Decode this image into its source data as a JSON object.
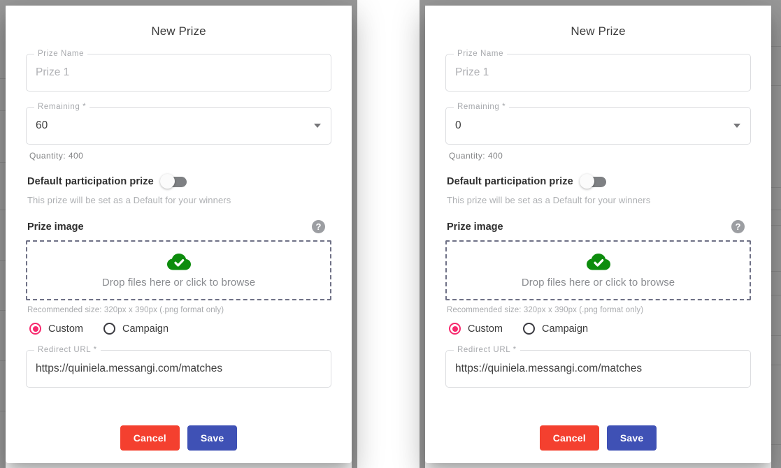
{
  "panels": [
    {
      "title": "New Prize",
      "prize_name": {
        "legend": "Prize Name",
        "value": "Prize 1"
      },
      "remaining": {
        "legend": "Remaining *",
        "value": "60"
      },
      "quantity_helper": "Quantity: 400",
      "default_prize": {
        "label": "Default participation prize",
        "sub": "This prize will be set as a Default for your winners",
        "state": "off"
      },
      "prize_image": {
        "title": "Prize image",
        "help_icon": "question-mark-icon",
        "dropzone_icon": "cloud-check-icon",
        "dropzone_text": "Drop files here or click to browse",
        "recommended": "Recommended size: 320px x 390px (.png format only)"
      },
      "image_source": {
        "options": [
          "Custom",
          "Campaign"
        ],
        "selected": "Custom"
      },
      "redirect_url": {
        "legend": "Redirect URL *",
        "value": "https://quiniela.messangi.com/matches"
      },
      "actions": {
        "cancel": "Cancel",
        "save": "Save"
      }
    },
    {
      "title": "New Prize",
      "prize_name": {
        "legend": "Prize Name",
        "value": "Prize 1"
      },
      "remaining": {
        "legend": "Remaining *",
        "value": "0"
      },
      "quantity_helper": "Quantity: 400",
      "default_prize": {
        "label": "Default participation prize",
        "sub": "This prize will be set as a Default for your winners",
        "state": "off"
      },
      "prize_image": {
        "title": "Prize image",
        "help_icon": "question-mark-icon",
        "dropzone_icon": "cloud-check-icon",
        "dropzone_text": "Drop files here or click to browse",
        "recommended": "Recommended size: 320px x 390px (.png format only)"
      },
      "image_source": {
        "options": [
          "Custom",
          "Campaign"
        ],
        "selected": "Custom"
      },
      "redirect_url": {
        "legend": "Redirect URL *",
        "value": "https://quiniela.messangi.com/matches"
      },
      "actions": {
        "cancel": "Cancel",
        "save": "Save"
      }
    }
  ],
  "colors": {
    "accent_pink": "#f7296e",
    "cancel_red": "#f4402f",
    "save_blue": "#3f51b5",
    "cloud_green": "#0d8c0d",
    "backdrop_gray": "#9a9a9a",
    "toggle_track_gray": "#7e8083"
  }
}
